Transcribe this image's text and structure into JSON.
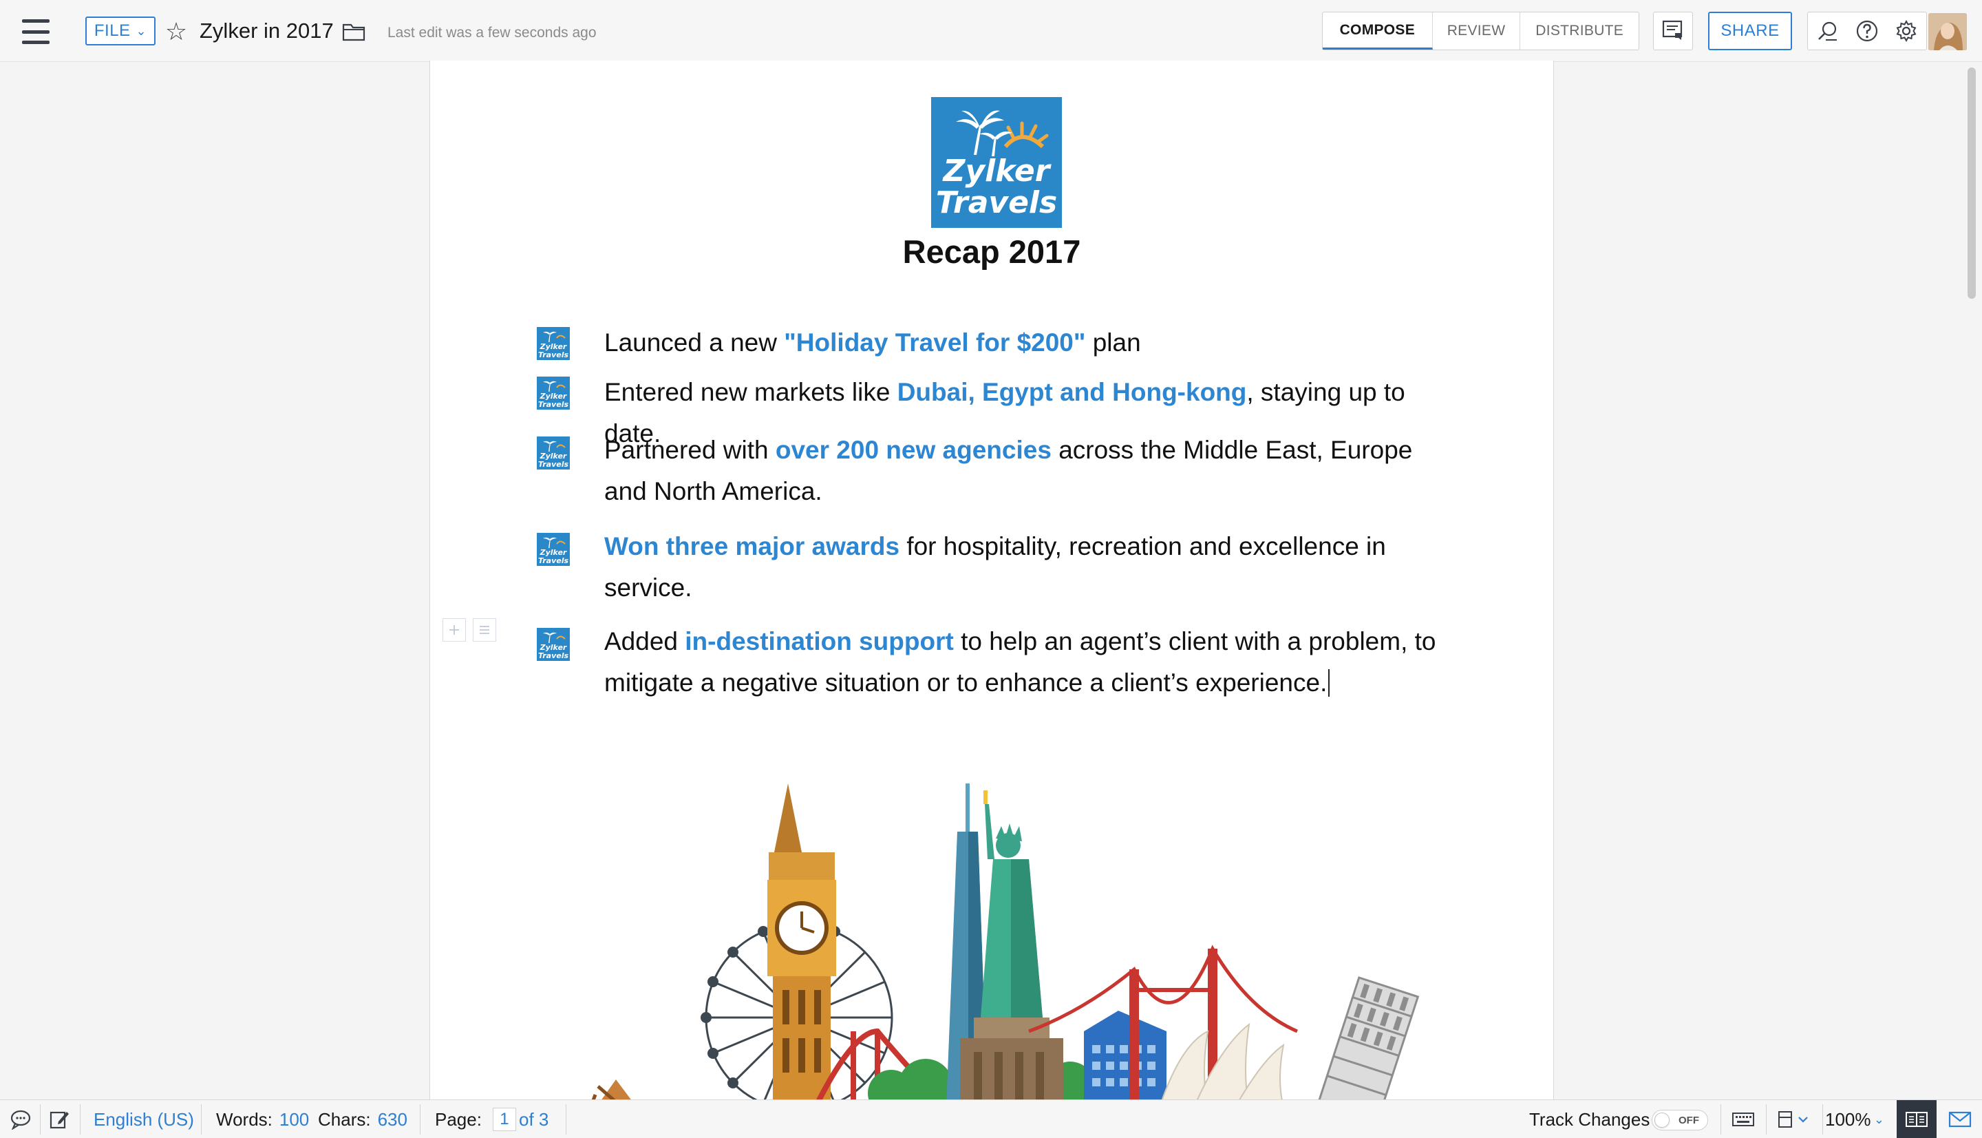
{
  "topbar": {
    "file_label": "FILE",
    "doc_title": "Zylker in 2017",
    "last_edit": "Last edit was a few seconds ago",
    "tabs": [
      {
        "label": "COMPOSE",
        "active": true
      },
      {
        "label": "REVIEW",
        "active": false
      },
      {
        "label": "DISTRIBUTE",
        "active": false
      }
    ],
    "share_label": "SHARE",
    "icons": [
      "menu-icon",
      "chevron-down-icon",
      "star-icon",
      "folder-icon",
      "comment-panel-icon",
      "search-icon",
      "help-icon",
      "gear-icon",
      "avatar"
    ]
  },
  "document": {
    "logo_lines": [
      "Zylker",
      "Travels"
    ],
    "heading": "Recap 2017",
    "bullets": [
      {
        "before": "Launced a new ",
        "highlight": "\"Holiday Travel for $200\"",
        "after": " plan"
      },
      {
        "before": "Entered new markets like ",
        "highlight": "Dubai, Egypt and Hong-kong",
        "after": ", staying up to date."
      },
      {
        "before": "Partnered with ",
        "highlight": "over 200 new agencies",
        "after": " across the Middle East, Europe and North America."
      },
      {
        "before": "",
        "highlight": "Won three major awards",
        "after": " for hospitality, recreation and excellence in service."
      },
      {
        "before": "Added ",
        "highlight": "in-destination support",
        "after": " to help an agent’s client with a problem, to mitigate a negative situation or to enhance a client’s experience."
      }
    ],
    "illustration": "world-landmarks-illustration"
  },
  "statusbar": {
    "language": "English (US)",
    "words_label": "Words:",
    "words_value": "100",
    "chars_label": "Chars:",
    "chars_value": "630",
    "page_label": "Page:",
    "page_value": "1",
    "page_total": "of 3",
    "track_changes_label": "Track Changes",
    "track_changes_state": "OFF",
    "zoom": "100%"
  },
  "colors": {
    "accent": "#2d7fd3",
    "highlight_text": "#2d86d2",
    "logo_bg": "#2a87c8"
  }
}
